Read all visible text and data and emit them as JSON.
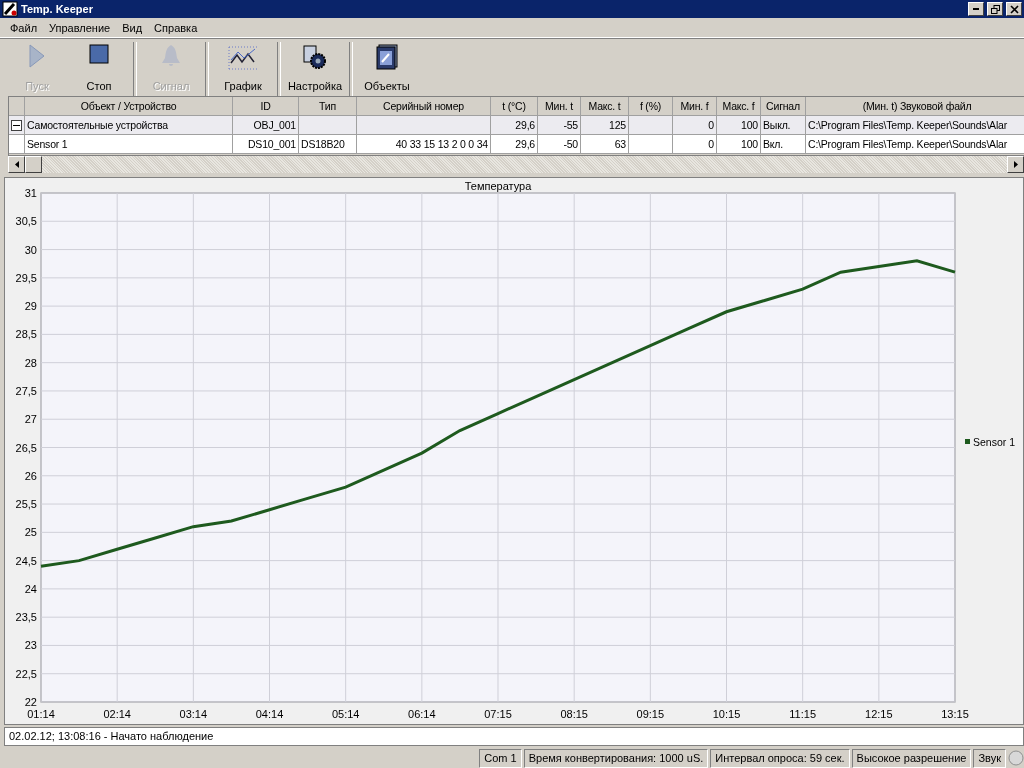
{
  "window": {
    "title": "Temp. Keeper"
  },
  "menu": [
    "Файл",
    "Управление",
    "Вид",
    "Справка"
  ],
  "toolbar": [
    [
      {
        "label": "Пуск",
        "kind": "play",
        "disabled": true
      },
      {
        "label": "Стоп",
        "kind": "stop",
        "disabled": false
      }
    ],
    [
      {
        "label": "Сигнал",
        "kind": "bell",
        "disabled": true
      }
    ],
    [
      {
        "label": "График",
        "kind": "chart",
        "disabled": false
      }
    ],
    [
      {
        "label": "Настройка",
        "kind": "gear",
        "disabled": false
      }
    ],
    [
      {
        "label": "Объекты",
        "kind": "objects",
        "disabled": false
      }
    ]
  ],
  "table": {
    "columns": [
      "Объект / Устройство",
      "ID",
      "Тип",
      "Серийный номер",
      "t (°C)",
      "Мин. t",
      "Макс. t",
      "f (%)",
      "Мин. f",
      "Макс. f",
      "Сигнал",
      "(Мин. t) Звуковой файл"
    ],
    "rows": [
      {
        "kind": "group",
        "expanded": true,
        "cells": [
          "Самостоятельные устройства",
          "OBJ_001",
          "",
          "",
          "29,6",
          "-55",
          "125",
          "",
          "0",
          "100",
          "Выкл.",
          "C:\\Program Files\\Temp. Keeper\\Sounds\\Alar"
        ]
      },
      {
        "kind": "device",
        "cells": [
          "Sensor 1",
          "DS10_001",
          "DS18B20",
          "40 33 15 13 2 0 0 34",
          "29,6",
          "-50",
          "63",
          "",
          "0",
          "100",
          "Вкл.",
          "C:\\Program Files\\Temp. Keeper\\Sounds\\Alar"
        ]
      }
    ]
  },
  "chart": {
    "chart_data": {
      "type": "line",
      "title": "Температура",
      "ylim": [
        22,
        31
      ],
      "grid": true,
      "categories": [
        "01:14",
        null,
        "02:14",
        null,
        "03:14",
        null,
        "04:14",
        null,
        "05:14",
        null,
        "06:14",
        null,
        "07:15",
        null,
        "08:15",
        null,
        "09:15",
        null,
        "10:15",
        null,
        "11:15",
        null,
        "12:15",
        null,
        "13:15"
      ],
      "series": [
        {
          "name": "Sensor 1",
          "color": "#1e5a1e",
          "values": [
            24.4,
            24.5,
            24.7,
            24.9,
            25.1,
            25.2,
            25.4,
            25.6,
            25.8,
            26.1,
            26.4,
            26.8,
            27.1,
            27.4,
            27.7,
            28.0,
            28.3,
            28.6,
            28.9,
            29.1,
            29.3,
            29.6,
            29.7,
            29.8,
            29.6
          ]
        }
      ],
      "yticks": [
        {
          "value": 22,
          "label": "22"
        },
        {
          "value": 22.5,
          "label": "22,5"
        },
        {
          "value": 23,
          "label": "23"
        },
        {
          "value": 23.5,
          "label": "23,5"
        },
        {
          "value": 24,
          "label": "24"
        },
        {
          "value": 24.5,
          "label": "24,5"
        },
        {
          "value": 25,
          "label": "25"
        },
        {
          "value": 25.5,
          "label": "25,5"
        },
        {
          "value": 26,
          "label": "26"
        },
        {
          "value": 26.5,
          "label": "26,5"
        },
        {
          "value": 27,
          "label": "27"
        },
        {
          "value": 27.5,
          "label": "27,5"
        },
        {
          "value": 28,
          "label": "28"
        },
        {
          "value": 28.5,
          "label": "28,5"
        },
        {
          "value": 29,
          "label": "29"
        },
        {
          "value": 29.5,
          "label": "29,5"
        },
        {
          "value": 30,
          "label": "30"
        },
        {
          "value": 30.5,
          "label": "30,5"
        },
        {
          "value": 31,
          "label": "31"
        }
      ]
    }
  },
  "log": "02.02.12; 13:08:16 - Начато наблюдение",
  "status_bar": [
    "Com 1",
    "Время конвертирования: 1000 uS.",
    "Интервал опроса: 59 сек.",
    "Высокое разрешение",
    "Звук"
  ]
}
